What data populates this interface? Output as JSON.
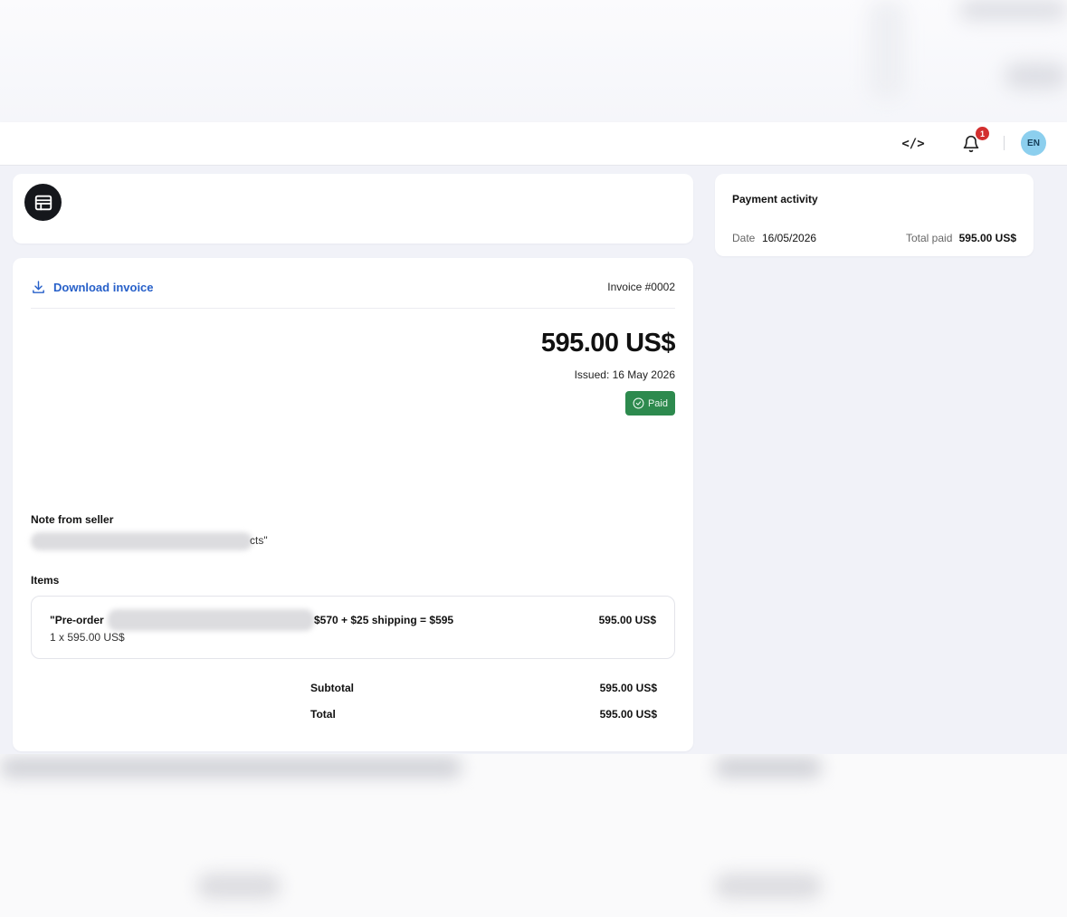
{
  "header": {
    "code_icon": "</>",
    "notification_count": "1",
    "language": "EN"
  },
  "invoice": {
    "download_label": "Download invoice",
    "invoice_number": "Invoice #0002",
    "amount": "595.00 US$",
    "issued": "Issued: 16 May 2026",
    "status": "Paid",
    "note_label": "Note from seller",
    "note_text_visible": "cts\"",
    "items_label": "Items",
    "items": [
      {
        "name_start": "\"Pre-order",
        "name_end": "$570 + $25 shipping = $595",
        "quantity": "1 x 595.00 US$",
        "price": "595.00 US$"
      }
    ],
    "subtotal_label": "Subtotal",
    "subtotal_value": "595.00 US$",
    "total_label": "Total",
    "total_value": "595.00 US$"
  },
  "payment_activity": {
    "title": "Payment activity",
    "date_label": "Date",
    "date_value": "16/05/2026",
    "total_paid_label": "Total paid",
    "total_paid_value": "595.00 US$"
  },
  "colors": {
    "accent_link": "#2760c9",
    "paid_green": "#2d8a4e",
    "badge_red": "#d32f2f",
    "avatar_blue": "#8ccfee"
  },
  "icons": {
    "code": "code-icon",
    "bell": "bell-icon",
    "store": "store-icon",
    "download": "download-icon",
    "check": "check-circle-icon"
  }
}
